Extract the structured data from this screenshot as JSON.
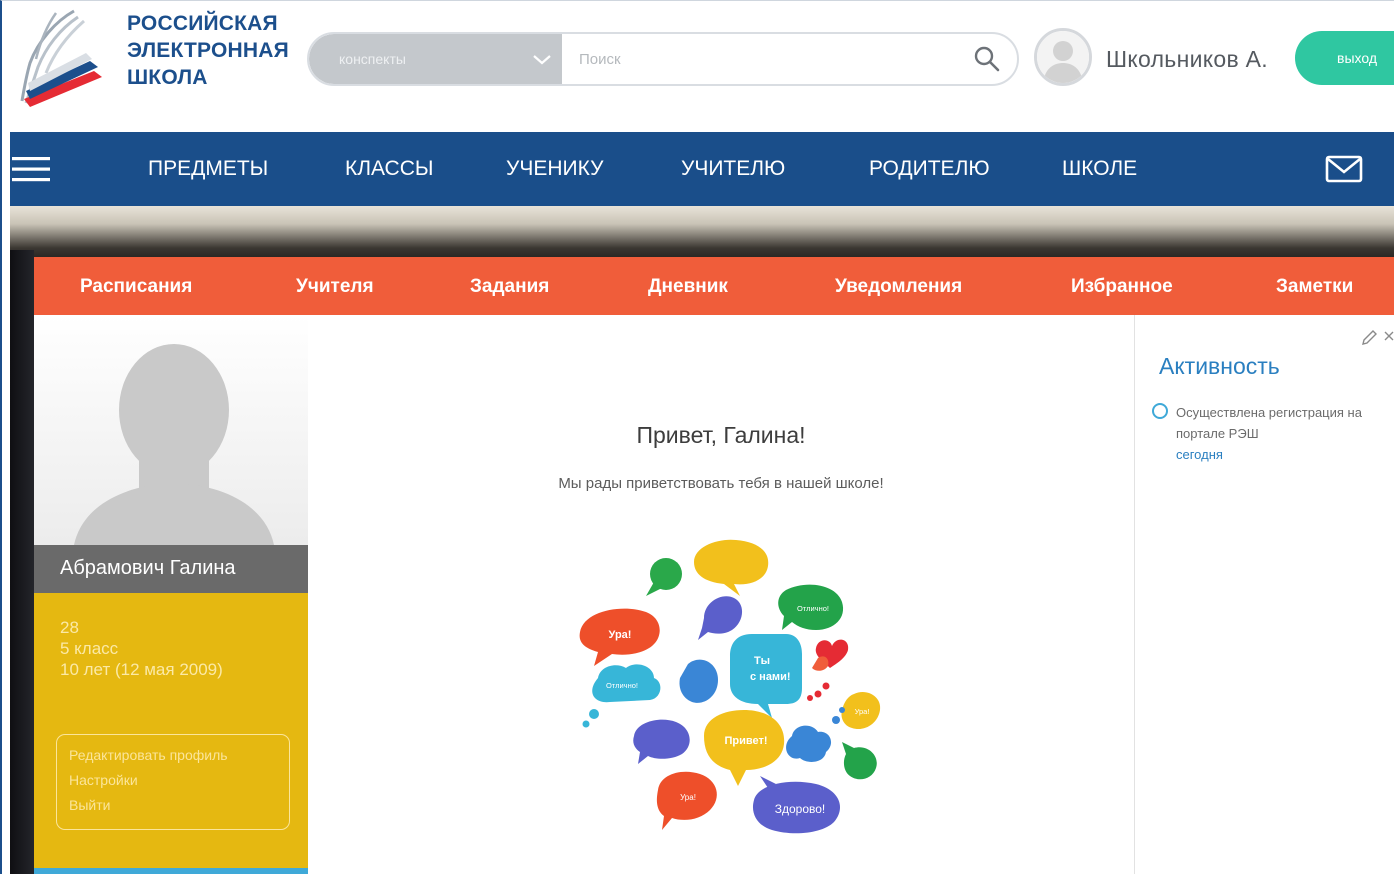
{
  "header": {
    "logo_lines": [
      "РОССИЙСКАЯ",
      "ЭЛЕКТРОННАЯ",
      "ШКОЛА"
    ],
    "search": {
      "category": "конспекты",
      "placeholder": "Поиск"
    },
    "user_name": "Школьников А.",
    "exit_label": "выход"
  },
  "main_nav": {
    "items": [
      "ПРЕДМЕТЫ",
      "КЛАССЫ",
      "УЧЕНИКУ",
      "УЧИТЕЛЮ",
      "РОДИТЕЛЮ",
      "ШКОЛЕ"
    ]
  },
  "sub_nav": {
    "items": [
      "Расписания",
      "Учителя",
      "Задания",
      "Дневник",
      "Уведомления",
      "Избранное",
      "Заметки"
    ]
  },
  "profile": {
    "name": "Абрамович Галина",
    "number": "28",
    "class": "5 класс",
    "age": "10 лет (12 мая 2009)",
    "menu": [
      "Редактировать профиль",
      "Настройки",
      "Выйти"
    ]
  },
  "greeting": {
    "title": "Привет, Галина!",
    "subtitle": "Мы рады приветствовать тебя в нашей школе!",
    "bubble_texts": [
      "Ура!",
      "Отлично!",
      "Ты",
      "с нами!",
      "Отлично!",
      "Ура!",
      "Привет!",
      "Ура!",
      "Здорово!"
    ]
  },
  "activity": {
    "title": "Активность",
    "item_text": "Осуществлена регистрация на портале РЭШ",
    "item_date": "сегодня"
  },
  "colors": {
    "brand_blue": "#1a4e8a",
    "accent_orange": "#f05d3a",
    "accent_green": "#2fc7a1",
    "profile_yellow": "#e5b811"
  }
}
